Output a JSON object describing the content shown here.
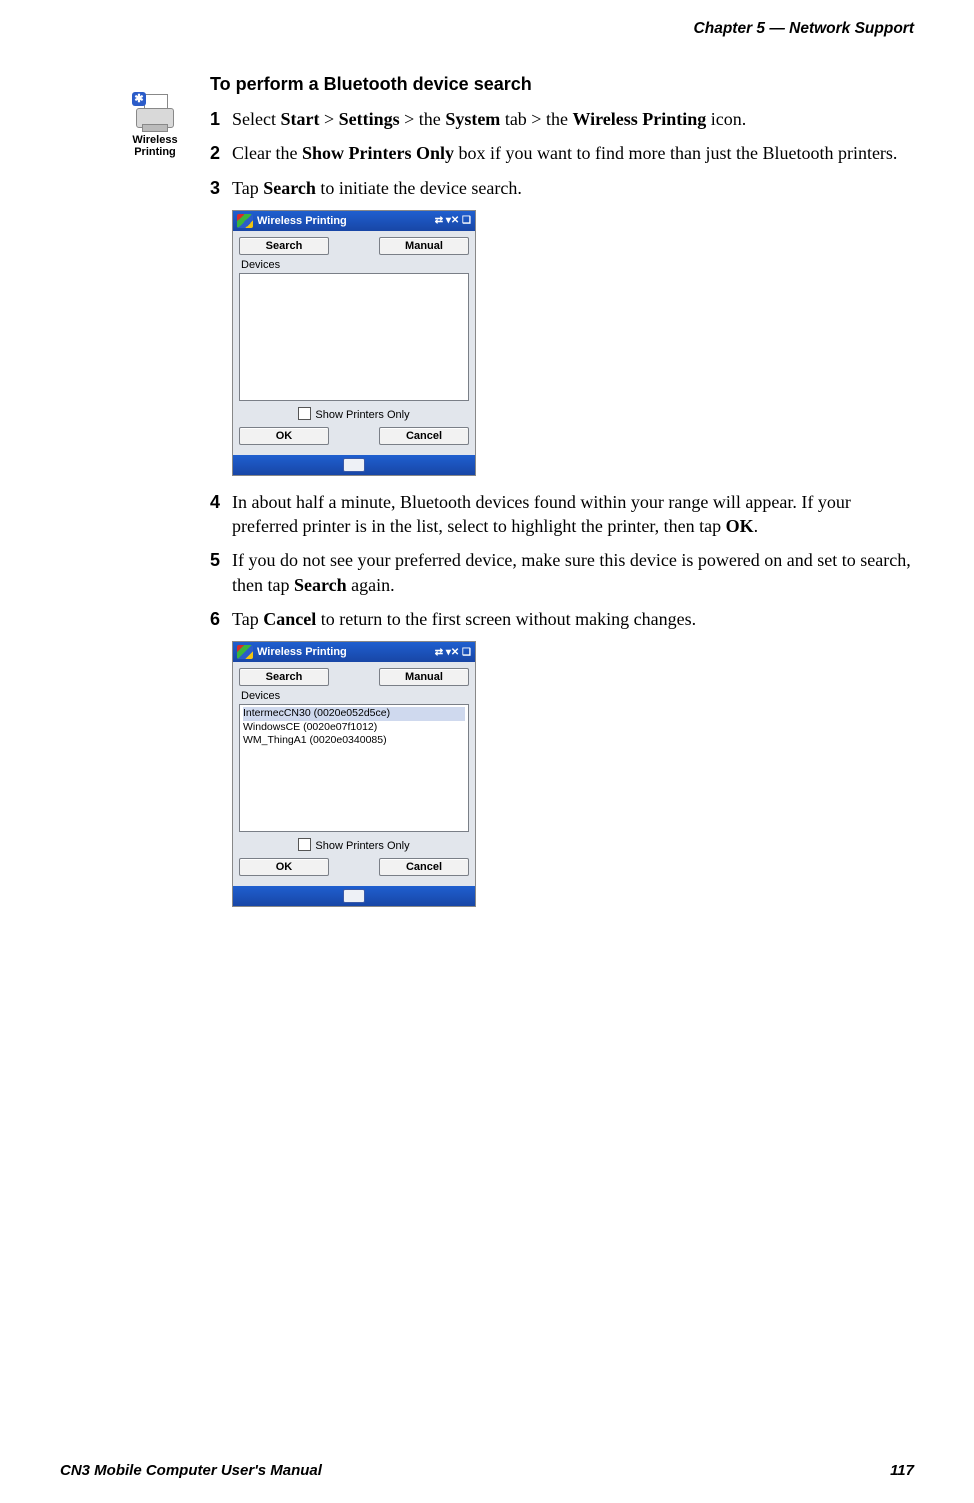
{
  "header": {
    "chapter": "Chapter 5 —  Network Support"
  },
  "icon": {
    "label_line1": "Wireless",
    "label_line2": "Printing",
    "bt_glyph": "✱"
  },
  "title": "To perform a Bluetooth device search",
  "steps": {
    "s1": {
      "num": "1",
      "pre": "Select ",
      "b1": "Start",
      "sep1": " > ",
      "b2": "Settings",
      "sep2": " > the ",
      "b3": "System",
      "mid": " tab > the ",
      "b4": "Wireless Printing",
      "post": " icon."
    },
    "s2": {
      "num": "2",
      "pre": "Clear the ",
      "b1": "Show Printers Only",
      "post": " box if you want to find more than just the Bluetooth printers."
    },
    "s3": {
      "num": "3",
      "pre": "Tap ",
      "b1": "Search",
      "post": " to initiate the device search."
    },
    "s4": {
      "num": "4",
      "pre": "In about half a minute, Bluetooth devices found within your range will appear. If your preferred printer is in the list, select to highlight the printer, then tap ",
      "b1": "OK",
      "post": "."
    },
    "s5": {
      "num": "5",
      "pre": "If you do not see your preferred device, make sure this device is powered on and set to search, then tap ",
      "b1": "Search",
      "post": " again."
    },
    "s6": {
      "num": "6",
      "pre": "Tap ",
      "b1": "Cancel",
      "post": " to return to the first screen without making changes."
    }
  },
  "wm": {
    "title": "Wireless Printing",
    "status_icons": "⇄  ▾✕  ❑",
    "search": "Search",
    "manual": "Manual",
    "devices_label": "Devices",
    "show_printers": "Show Printers Only",
    "ok": "OK",
    "cancel": "Cancel",
    "list2": {
      "d1": "IntermecCN30 (0020e052d5ce)",
      "d2": "WindowsCE (0020e07f1012)",
      "d3": "WM_ThingA1 (0020e0340085)"
    }
  },
  "footer": {
    "left": "CN3 Mobile Computer User's Manual",
    "right": "117"
  }
}
